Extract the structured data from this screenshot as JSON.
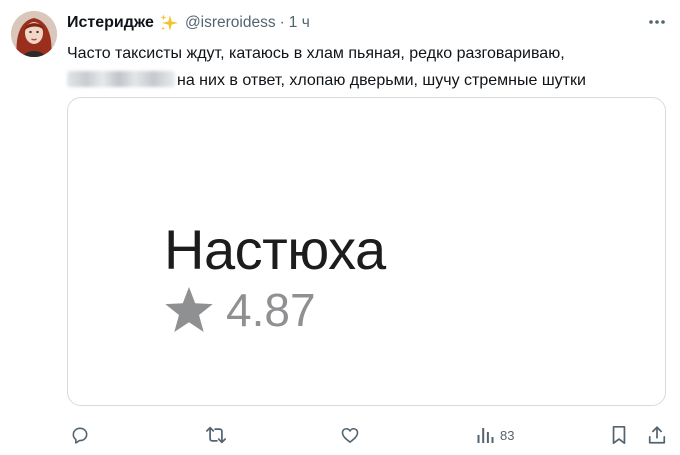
{
  "tweet": {
    "display_name": "Истеридже",
    "handle": "@isreroidess",
    "separator": "·",
    "time": "1 ч",
    "text_line_1": "Часто таксисты ждут, катаюсь в хлам пьяная, редко разговариваю,",
    "text_line_2": "на них в ответ, хлопаю дверьми, шучу стремные шутки",
    "icons": {
      "verified_decoration": "sparkles-icon",
      "more": "more-horizontal-icon"
    }
  },
  "card": {
    "name": "Настюха",
    "rating": "4.87",
    "star_icon": "star-icon"
  },
  "actions": {
    "reply_icon": "reply-icon",
    "retweet_icon": "retweet-icon",
    "like_icon": "heart-icon",
    "views_icon": "views-icon",
    "views_count": "83",
    "bookmark_icon": "bookmark-icon",
    "share_icon": "share-icon"
  },
  "colors": {
    "text_primary": "#0f1419",
    "text_secondary": "#536471",
    "border": "#d6dbdf",
    "sparkle": "#f4c430",
    "star": "#8f9092",
    "card_name": "#1c1c1c"
  }
}
